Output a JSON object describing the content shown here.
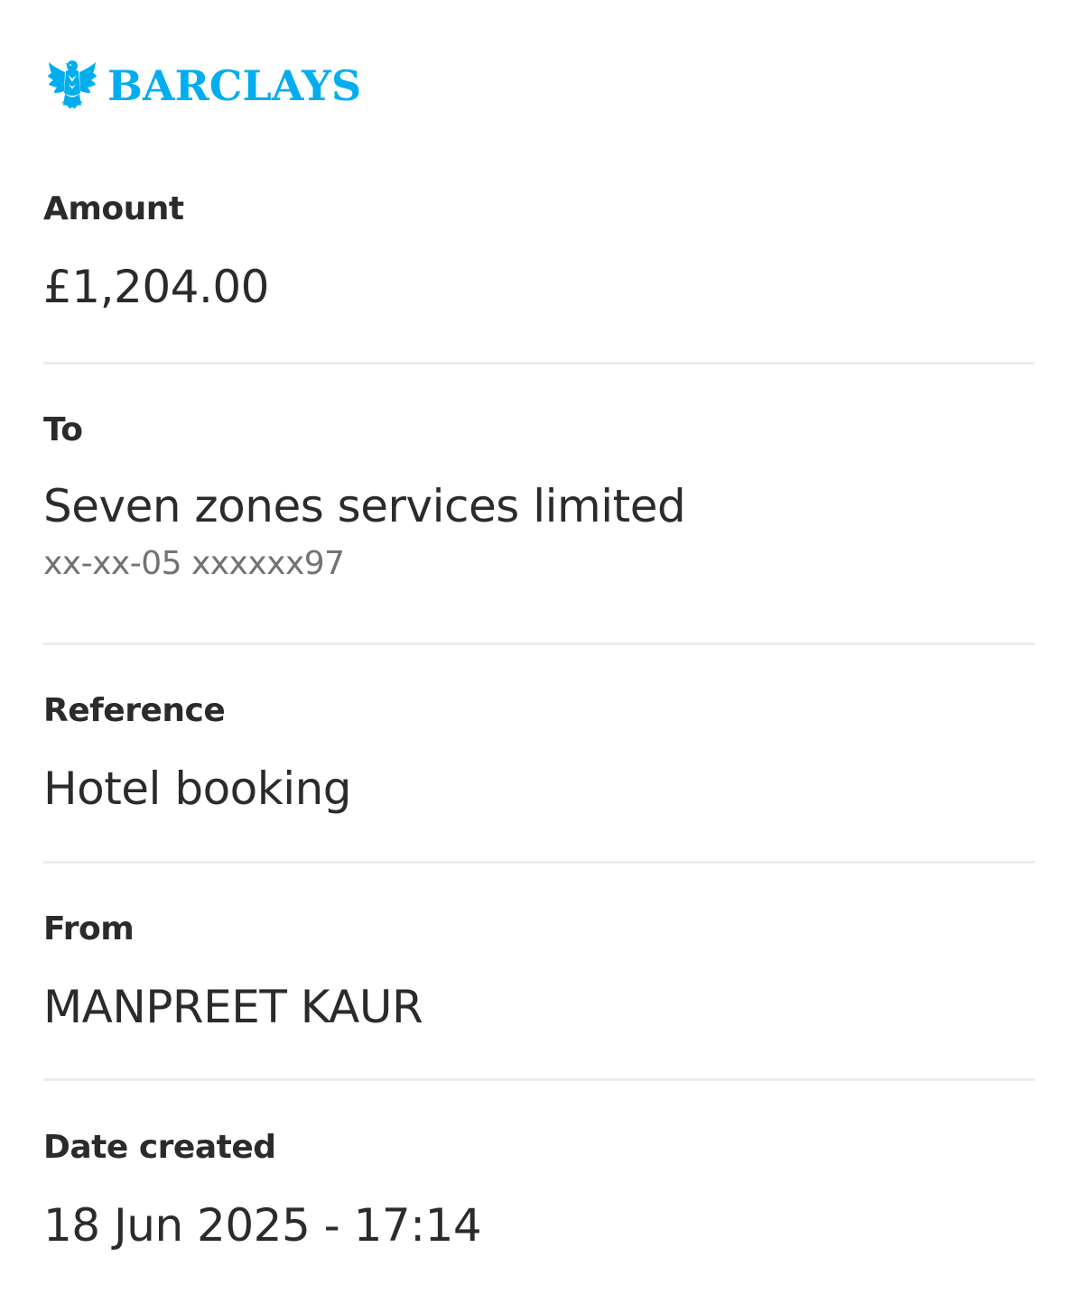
{
  "brand": {
    "name": "BARCLAYS",
    "logo_icon": "eagle-icon",
    "color": "#00aeef"
  },
  "details": {
    "amount": {
      "label": "Amount",
      "value": "£1,204.00"
    },
    "to": {
      "label": "To",
      "value": "Seven zones services limited",
      "account": "xx-xx-05 xxxxxx97"
    },
    "reference": {
      "label": "Reference",
      "value": "Hotel booking"
    },
    "from": {
      "label": "From",
      "value": "MANPREET KAUR"
    },
    "date_created": {
      "label": "Date created",
      "value": "18 Jun 2025 - 17:14"
    }
  },
  "colors": {
    "text": "#2b2b2b",
    "secondary_text": "#727272",
    "divider": "#ececec"
  }
}
